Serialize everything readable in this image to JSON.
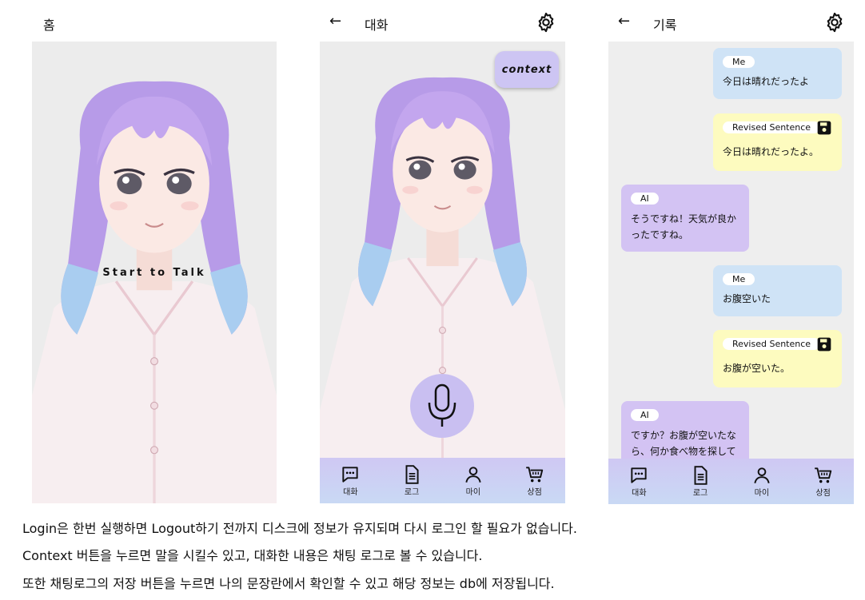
{
  "screens": [
    {
      "title": "홈",
      "overlay_text": "Start to Talk"
    },
    {
      "title": "대화",
      "context_button": "context"
    },
    {
      "title": "기록",
      "messages": [
        {
          "role": "Me",
          "text": "今日は晴れだったよ",
          "kind": "me"
        },
        {
          "role": "Revised Sentence",
          "text": "今日は晴れだったよ。",
          "kind": "rev"
        },
        {
          "role": "AI",
          "text": "そうですね！天気が良かったですね。",
          "kind": "ai"
        },
        {
          "role": "Me",
          "text": "お腹空いた",
          "kind": "me"
        },
        {
          "role": "Revised Sentence",
          "text": "お腹が空いた。",
          "kind": "rev"
        },
        {
          "role": "AI",
          "text": "ですか？お腹が空いたなら、何か食べ物を探して",
          "kind": "ai"
        }
      ]
    }
  ],
  "nav": {
    "chat": "대화",
    "log": "로그",
    "my": "마이",
    "shop": "상점"
  },
  "captions": [
    "Login은 한번 실행하면 Logout하기 전까지 디스크에 정보가 유지되며 다시 로그인 할 필요가 없습니다.",
    "Context 버튼을 누르면 말을 시킬수 있고, 대화한 내용은 채팅 로그로 볼 수 있습니다.",
    "또한 채팅로그의 저장 버튼을 누르면 나의 문장란에서 확인할 수 있고 해당 정보는 db에 저장됩니다."
  ],
  "icons": [
    "back-arrow-icon",
    "gear-icon",
    "microphone-icon",
    "chat-bubble-icon",
    "document-icon",
    "person-icon",
    "cart-icon",
    "save-icon"
  ],
  "colors": {
    "nav_bg": "#cfc8f3",
    "me_bubble": "#cfe3f6",
    "revised_bubble": "#fdfbbf",
    "ai_bubble": "#d3c3f3",
    "hair": "#b79be8"
  }
}
